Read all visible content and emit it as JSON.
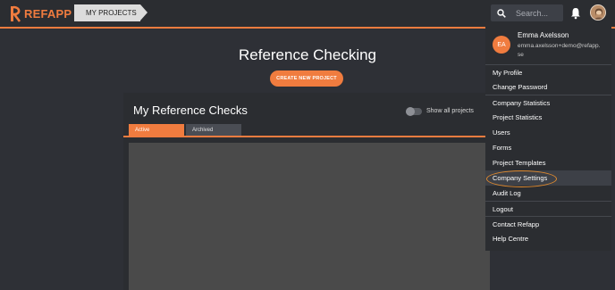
{
  "header": {
    "logo_text": "REFAPP",
    "nav_tab": "MY PROJECTS",
    "search_placeholder": "Search...",
    "accent_color": "#f07c3f"
  },
  "main": {
    "title": "Reference Checking",
    "create_button": "CREATE NEW PROJECT",
    "panel": {
      "title": "My Reference Checks",
      "toggle_label": "Show all projects",
      "tabs": [
        "Active",
        "Archived"
      ],
      "active_tab": "Active"
    }
  },
  "user_menu": {
    "initials": "EA",
    "name": "Emma Axelsson",
    "email": "emma.axelsson+demo@refapp.se",
    "items": [
      "My Profile",
      "Change Password",
      "Company Statistics",
      "Project Statistics",
      "Users",
      "Forms",
      "Project Templates",
      "Company Settings",
      "Audit Log",
      "Logout",
      "Contact Refapp",
      "Help Centre"
    ],
    "highlighted": "Company Settings"
  },
  "icons": {
    "search": "search-icon",
    "bell": "bell-icon",
    "avatar": "avatar",
    "logo": "refapp-logo-icon"
  }
}
